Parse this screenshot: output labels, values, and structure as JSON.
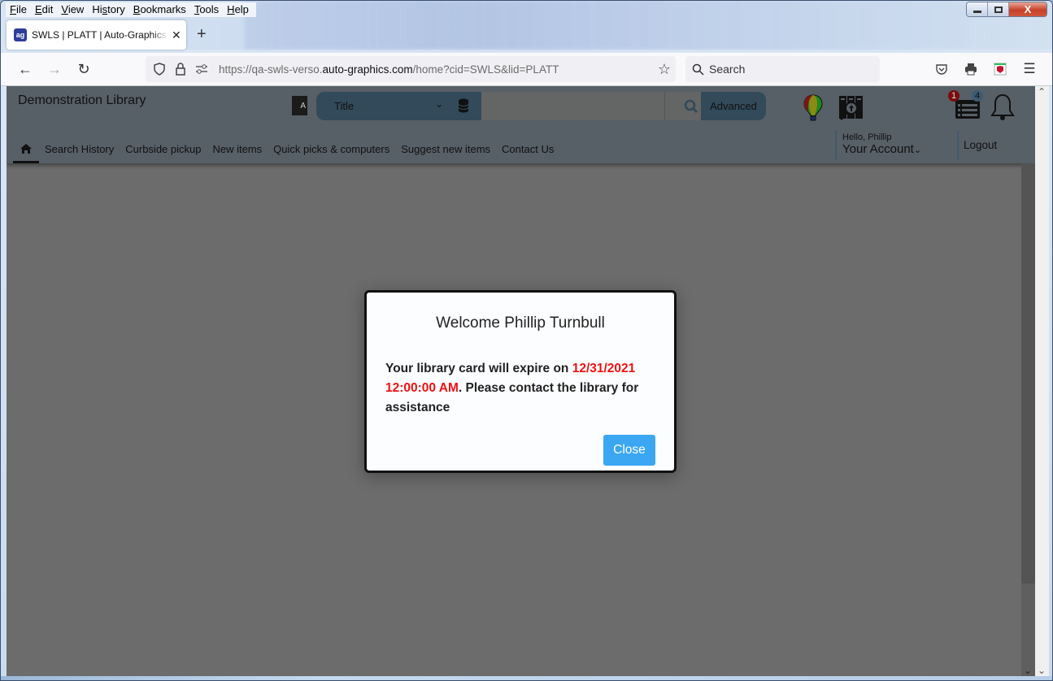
{
  "browser": {
    "menu": [
      {
        "label": "File",
        "accel": "F",
        "rest": "ile"
      },
      {
        "label": "Edit",
        "accel": "E",
        "rest": "dit"
      },
      {
        "label": "View",
        "accel": "V",
        "rest": "iew"
      },
      {
        "label": "History",
        "pre": "Hi",
        "accel": "s",
        "rest": "tory"
      },
      {
        "label": "Bookmarks",
        "accel": "B",
        "rest": "ookmarks"
      },
      {
        "label": "Tools",
        "accel": "T",
        "rest": "ools"
      },
      {
        "label": "Help",
        "accel": "H",
        "rest": "elp"
      }
    ],
    "tab": {
      "title": "SWLS | PLATT | Auto-Graphics Inc",
      "favicon": "ag"
    },
    "url": {
      "prefix": "https://qa-swls-verso.",
      "domain": "auto-graphics.com",
      "suffix": "/home?cid=SWLS&lid=PLATT"
    },
    "search_placeholder": "Search",
    "window_controls": {
      "close": "X"
    }
  },
  "site": {
    "library_name": "Demonstration Library",
    "search": {
      "type_selected": "Title",
      "input_value": "",
      "advanced_label": "Advanced"
    },
    "badges": {
      "list_count": "1",
      "notifications_count": "4"
    },
    "nav_links": [
      "Search History",
      "Curbside pickup",
      "New items",
      "Quick picks & computers",
      "Suggest new items",
      "Contact Us"
    ],
    "account": {
      "greeting": "Hello, Phillip",
      "label": "Your Account",
      "logout": "Logout"
    }
  },
  "modal": {
    "title": "Welcome Phillip Turnbull",
    "message_prefix": "Your library card will expire on ",
    "expiry": "12/31/2021 12:00:00 AM",
    "message_suffix": ". Please contact the library for assistance",
    "close_label": "Close",
    "colors": {
      "button": "#3ba7f3",
      "expiry": "#ee1111"
    }
  }
}
